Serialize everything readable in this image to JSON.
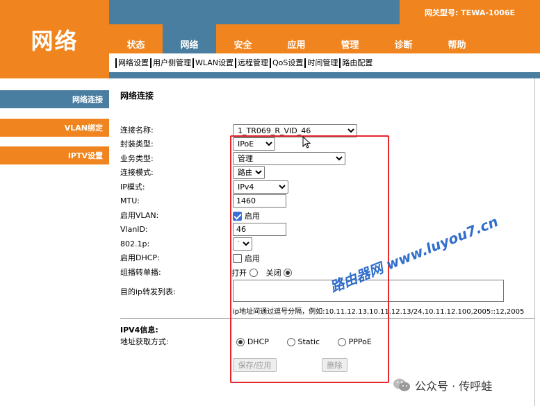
{
  "logo": "网络",
  "gateway_model": "网关型号: TEWA-1006E",
  "tabs": [
    {
      "label": "状态"
    },
    {
      "label": "网络"
    },
    {
      "label": "安全"
    },
    {
      "label": "应用"
    },
    {
      "label": "管理"
    },
    {
      "label": "诊断"
    },
    {
      "label": "帮助"
    }
  ],
  "subnav": [
    {
      "label": "网络设置"
    },
    {
      "label": "用户侧管理"
    },
    {
      "label": "WLAN设置"
    },
    {
      "label": "远程管理"
    },
    {
      "label": "QoS设置"
    },
    {
      "label": "时间管理"
    },
    {
      "label": "路由配置"
    }
  ],
  "sidebar": [
    {
      "label": "网络连接"
    },
    {
      "label": "VLAN绑定"
    },
    {
      "label": "IPTV设置"
    }
  ],
  "section_title": "网络连接",
  "form": {
    "conn_name": {
      "label": "连接名称:",
      "value": "1_TR069_R_VID_46"
    },
    "encap": {
      "label": "封装类型:",
      "value": "IPoE"
    },
    "service": {
      "label": "业务类型:",
      "value": "管理"
    },
    "mode": {
      "label": "连接模式:",
      "value": "路由"
    },
    "ip_mode": {
      "label": "IP模式:",
      "value": "IPv4"
    },
    "mtu": {
      "label": "MTU:",
      "value": "1460"
    },
    "vlan_enable": {
      "label": "启用VLAN:",
      "option": "启用"
    },
    "vlan_id": {
      "label": "VlanID:",
      "value": "46"
    },
    "p8021": {
      "label": "802.1p:",
      "value": "7"
    },
    "dhcp_enable": {
      "label": "启用DHCP:",
      "option": "启用"
    },
    "multicast": {
      "label": "组播转单播:",
      "on": "打开",
      "off": "关闭"
    },
    "dest_ip": {
      "label": "目的ip转发列表:",
      "value": ""
    },
    "hint": "ip地址间通过逗号分隔，例如:10.11.12.13,10.11.12.13/24,10.11.12.100,2005::12,2005"
  },
  "ipv4": {
    "title": "IPV4信息:",
    "addr_label": "地址获取方式:",
    "dhcp": "DHCP",
    "static": "Static",
    "pppoe": "PPPoE"
  },
  "buttons": {
    "save": "保存/应用",
    "delete": "删除"
  },
  "watermark": "路由器网 www.luyou7.cn",
  "wechat": "公众号 · 传呼蛙"
}
